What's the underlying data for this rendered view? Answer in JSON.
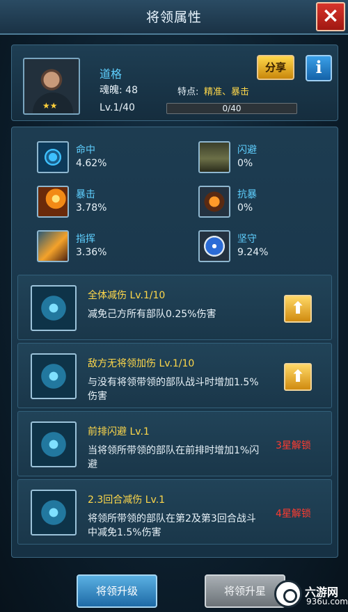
{
  "window": {
    "title": "将领属性",
    "close_icon": "×"
  },
  "hero": {
    "name": "道格",
    "soul": "魂魄: 48",
    "trait_label": "特点:",
    "trait_value": "精准、暴击",
    "level": "Lv.1/40",
    "exp_text": "0/40",
    "exp_fraction": 0,
    "stars": "★★",
    "share_label": "分享",
    "info_label": "i"
  },
  "stats": [
    {
      "name": "命中",
      "value": "4.62%",
      "icon": "target-icon"
    },
    {
      "name": "闪避",
      "value": "0%",
      "icon": "tank-icon"
    },
    {
      "name": "暴击",
      "value": "3.78%",
      "icon": "missile-icon"
    },
    {
      "name": "抗暴",
      "value": "0%",
      "icon": "armor-shield-icon"
    },
    {
      "name": "指挥",
      "value": "3.36%",
      "icon": "rocket-icon"
    },
    {
      "name": "坚守",
      "value": "9.24%",
      "icon": "star-shield-icon"
    }
  ],
  "skills": [
    {
      "name": "全体减伤 Lv.1/10",
      "desc": "减免己方所有部队0.25%伤害",
      "action": "upgrade",
      "action_label": "⬆"
    },
    {
      "name": "敌方无将领加伤 Lv.1/10",
      "desc": "与没有将领带领的部队战斗时增加1.5%伤害",
      "action": "upgrade",
      "action_label": "⬆"
    },
    {
      "name": "前排闪避 Lv.1",
      "desc": "当将领所带领的部队在前排时增加1%闪避",
      "action": "locked",
      "action_label": "3星解锁"
    },
    {
      "name": "2.3回合减伤 Lv.1",
      "desc": "将领所带领的部队在第2及第3回合战斗中减免1.5%伤害",
      "action": "locked",
      "action_label": "4星解锁"
    }
  ],
  "buttons": {
    "levelup": "将领升级",
    "starup": "将领升星"
  },
  "watermark": {
    "name": "六游网",
    "url": "936u.com"
  },
  "colors": {
    "accent_blue": "#5fd0ff",
    "skill_yellow": "#ffd84a",
    "lock_red": "#ff3b30",
    "exp_green": "#3fb35a"
  }
}
